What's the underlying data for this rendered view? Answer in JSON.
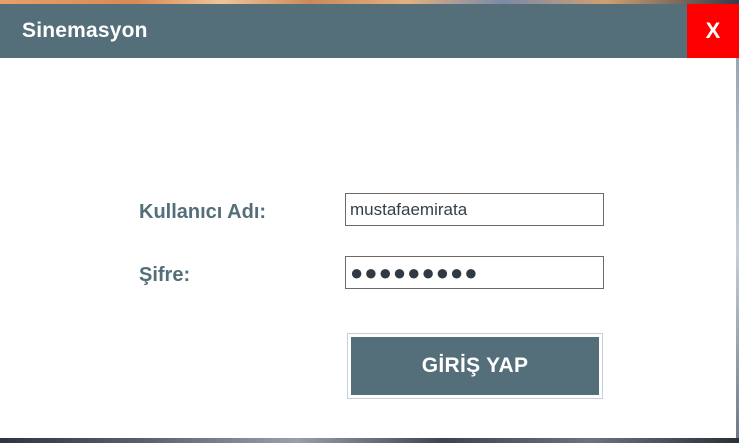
{
  "window": {
    "title": "Sinemasyon",
    "close_label": "X"
  },
  "form": {
    "username_label": "Kullanıcı Adı:",
    "username_value": "mustafaemirata",
    "password_label": "Şifre:",
    "password_value": "●●●●●●●●●",
    "login_label": "GİRİŞ YAP"
  },
  "colors": {
    "titlebar": "#546e7a",
    "close_button": "#ff0000",
    "label_text": "#546e7a",
    "button": "#546e7a"
  },
  "icons": {
    "close": "close-icon"
  }
}
